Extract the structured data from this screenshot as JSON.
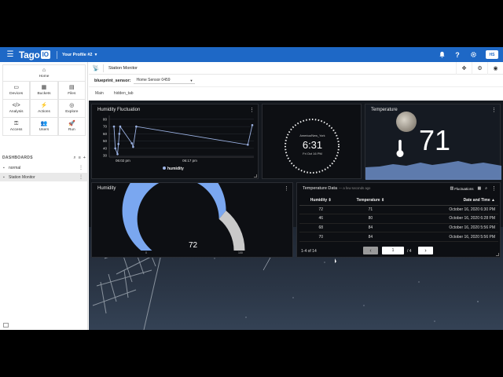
{
  "topbar": {
    "logo_text": "Tago",
    "logo_badge": "IO",
    "profile": "Your Profile #2",
    "avatar": "HS",
    "icons": [
      "bell-icon",
      "help-icon",
      "settings-icon"
    ]
  },
  "sidebar": {
    "home_label": "Home",
    "nav": [
      {
        "label": "Devices",
        "icon": "devices-icon"
      },
      {
        "label": "Buckets",
        "icon": "buckets-icon"
      },
      {
        "label": "Files",
        "icon": "files-icon"
      },
      {
        "label": "Analysis",
        "icon": "analysis-icon"
      },
      {
        "label": "Actions",
        "icon": "actions-icon"
      },
      {
        "label": "Explore",
        "icon": "explore-icon"
      },
      {
        "label": "Access",
        "icon": "access-icon"
      },
      {
        "label": "Users",
        "icon": "users-icon"
      },
      {
        "label": "Run",
        "icon": "run-icon"
      }
    ],
    "dashboards_title": "DASHBOARDS",
    "dashboards": [
      {
        "label": "normal",
        "active": false
      },
      {
        "label": "Station Monitor",
        "active": true
      }
    ]
  },
  "header": {
    "title": "Station Monitor",
    "blueprint_label": "blueprint_sensor:",
    "blueprint_value": "Home Sensor 0459",
    "tabs": [
      "Main",
      "hidden_tab"
    ]
  },
  "widgets": {
    "humidity_fluctuation": {
      "title": "Humidity Fluctuation",
      "chart_data": {
        "type": "line",
        "x": [
          "06:00 pm",
          "06:00 pm",
          "06:01 pm",
          "06:01 pm",
          "06:01 pm",
          "06:01 pm",
          "06:04 pm",
          "06:04 pm",
          "06:05 pm",
          "06:30 pm",
          "06:31 pm"
        ],
        "series": [
          {
            "name": "humidity",
            "values": [
              70,
              40,
              32,
              46,
              60,
              70,
              47,
              42,
              70,
              45,
              72
            ]
          }
        ],
        "xticks": [
          "06:02 pm",
          "06:17 pm"
        ],
        "yticks": [
          30,
          40,
          50,
          60,
          70,
          80
        ],
        "ylim": [
          28,
          82
        ],
        "legend_position": "bottom"
      }
    },
    "clock": {
      "timezone": "America/New_York",
      "time": "6:31",
      "date": "Fri Oct 16 PM"
    },
    "temperature": {
      "title": "Temperature",
      "value": "71"
    },
    "humidity": {
      "title": "Humidity",
      "value": "72",
      "min": "0",
      "max": "100",
      "fill_percent": 72
    },
    "temperature_data": {
      "title": "Temperature Data",
      "subtitle": "— a few seconds ago",
      "filter_label": "Fluctuations",
      "columns": [
        "Humidity",
        "Temperature",
        "Date and Time"
      ],
      "rows": [
        [
          "72",
          "71",
          "October 16, 2020 6:30 PM"
        ],
        [
          "46",
          "80",
          "October 16, 2020 6:28 PM"
        ],
        [
          "68",
          "84",
          "October 16, 2020 5:56 PM"
        ],
        [
          "70",
          "84",
          "October 16, 2020 5:56 PM"
        ]
      ],
      "range_text": "1-4 of 14",
      "page": "1",
      "page_total": "/ 4"
    }
  },
  "colors": {
    "brand": "#1e68c6",
    "widget_bg": "#0d0f13",
    "gauge_fill": "#7aa7f0",
    "gauge_empty": "#c9c9c9",
    "line": "#9db4e6"
  }
}
